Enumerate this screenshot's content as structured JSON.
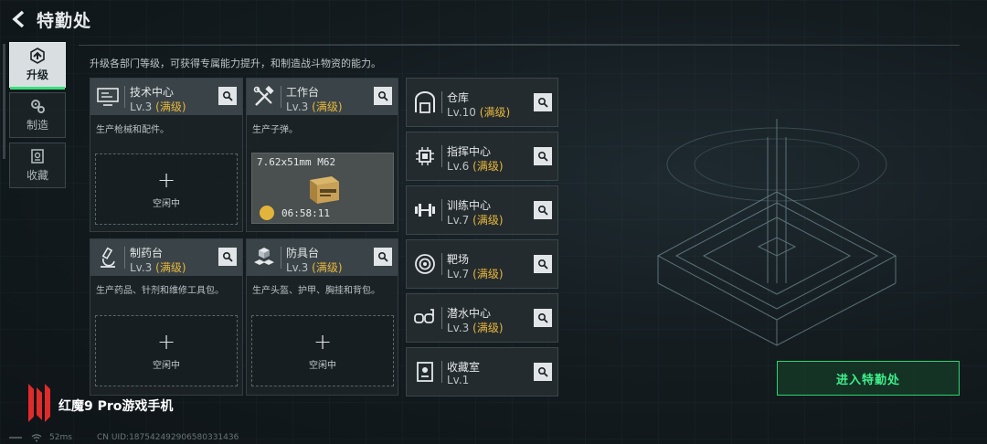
{
  "header": {
    "title": "特勤处"
  },
  "sidebar": {
    "items": [
      {
        "label": "升级",
        "icon": "upgrade-icon",
        "active": true
      },
      {
        "label": "制造",
        "icon": "gears-icon",
        "active": false
      },
      {
        "label": "收藏",
        "icon": "collection-icon",
        "active": false
      }
    ]
  },
  "main": {
    "description": "升级各部门等级，可获得专属能力提升，和制造战斗物资的能力。",
    "cards": [
      {
        "name": "技术中心",
        "level": "Lv.3",
        "max": "(满级)",
        "desc": "生产枪械和配件。",
        "slot": {
          "plus": "+",
          "status": "空闲中"
        }
      },
      {
        "name": "工作台",
        "level": "Lv.3",
        "max": "(满级)",
        "desc": "生产子弹。",
        "production": {
          "item": "7.62x51mm M62",
          "timer": "06:58:11"
        }
      },
      {
        "name": "制药台",
        "level": "Lv.3",
        "max": "(满级)",
        "desc": "生产药品、针剂和维修工具包。",
        "slot": {
          "plus": "+",
          "status": "空闲中"
        }
      },
      {
        "name": "防具台",
        "level": "Lv.3",
        "max": "(满级)",
        "desc": "生产头盔、护甲、胸挂和背包。",
        "slot": {
          "plus": "+",
          "status": "空闲中"
        }
      }
    ],
    "rows": [
      {
        "name": "仓库",
        "level": "Lv.10",
        "max": "(满级)",
        "icon": "warehouse-icon"
      },
      {
        "name": "指挥中心",
        "level": "Lv.6",
        "max": "(满级)",
        "icon": "chip-icon"
      },
      {
        "name": "训练中心",
        "level": "Lv.7",
        "max": "(满级)",
        "icon": "dumbbell-icon"
      },
      {
        "name": "靶场",
        "level": "Lv.7",
        "max": "(满级)",
        "icon": "target-icon"
      },
      {
        "name": "潜水中心",
        "level": "Lv.3",
        "max": "(满级)",
        "icon": "diving-mask-icon"
      },
      {
        "name": "收藏室",
        "level": "Lv.1",
        "max": "",
        "icon": "trophy-case-icon"
      }
    ]
  },
  "enter_button": {
    "label": "进入特勤处"
  },
  "watermark": {
    "text": "红魔9 Pro游戏手机"
  },
  "footer": {
    "ping": "52ms",
    "uid": "CN UID:187542492906580331436"
  },
  "colors": {
    "accent_green": "#39e07c",
    "max_level": "#e9b83c"
  }
}
